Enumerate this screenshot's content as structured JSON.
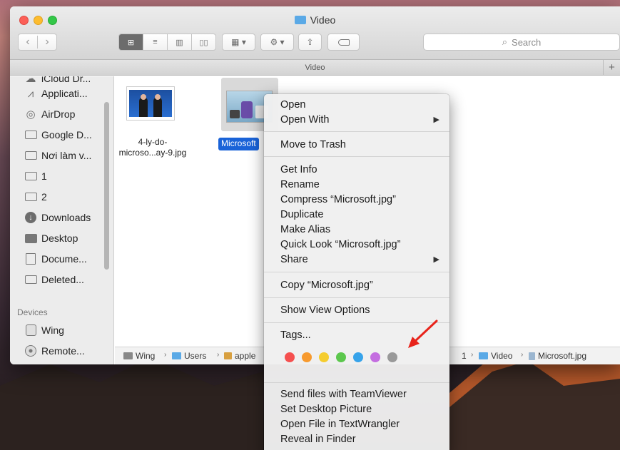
{
  "window": {
    "title": "Video"
  },
  "toolbar": {
    "back": "‹",
    "forward": "›",
    "views": [
      "⊞",
      "≡",
      "▥",
      "▯▯"
    ],
    "arrange_icon": "▦ ▾",
    "action_icon": "⚙ ▾",
    "share_icon": "⇧",
    "search_placeholder": "Search",
    "search_icon": "⌕"
  },
  "path_header": {
    "title": "Video",
    "plus": "+"
  },
  "sidebar": {
    "items": [
      {
        "label": "iCloud Dr...",
        "icon": "cloud-icon"
      },
      {
        "label": "Applicati...",
        "icon": "applications-icon"
      },
      {
        "label": "AirDrop",
        "icon": "airdrop-icon"
      },
      {
        "label": "Google D...",
        "icon": "folder-icon"
      },
      {
        "label": "Nơi làm v...",
        "icon": "folder-icon"
      },
      {
        "label": "1",
        "icon": "folder-icon"
      },
      {
        "label": "2",
        "icon": "folder-icon"
      },
      {
        "label": "Downloads",
        "icon": "downloads-icon"
      },
      {
        "label": "Desktop",
        "icon": "desktop-icon"
      },
      {
        "label": "Docume...",
        "icon": "documents-icon"
      },
      {
        "label": "Deleted...",
        "icon": "folder-icon"
      }
    ],
    "section_devices": "Devices",
    "devices": [
      {
        "label": "Wing",
        "icon": "hard-drive-icon"
      },
      {
        "label": "Remote...",
        "icon": "remote-disc-icon"
      }
    ]
  },
  "files": [
    {
      "name_line1": "4-ly-do-",
      "name_line2": "microso...ay-9.jpg"
    },
    {
      "name": "Microsoft"
    }
  ],
  "pathbar": {
    "items": [
      "Wing",
      "Users",
      "apple",
      "1",
      "Video",
      "Microsoft.jpg"
    ],
    "sep": "›"
  },
  "context_menu": {
    "open": "Open",
    "open_with": "Open With",
    "move_to_trash": "Move to Trash",
    "get_info": "Get Info",
    "rename": "Rename",
    "compress": "Compress “Microsoft.jpg”",
    "duplicate": "Duplicate",
    "make_alias": "Make Alias",
    "quick_look": "Quick Look “Microsoft.jpg”",
    "share": "Share",
    "copy": "Copy “Microsoft.jpg”",
    "show_view_options": "Show View Options",
    "tags": "Tags...",
    "teamviewer": "Send files with TeamViewer",
    "set_desktop": "Set Desktop Picture",
    "textwrangler": "Open File in TextWrangler",
    "reveal": "Reveal in Finder",
    "submenu_arrow": "▶",
    "tag_colors": [
      "#f5504f",
      "#f79a2e",
      "#f5cd2f",
      "#5cc74d",
      "#37a3ea",
      "#c46ee0",
      "#999999"
    ]
  }
}
